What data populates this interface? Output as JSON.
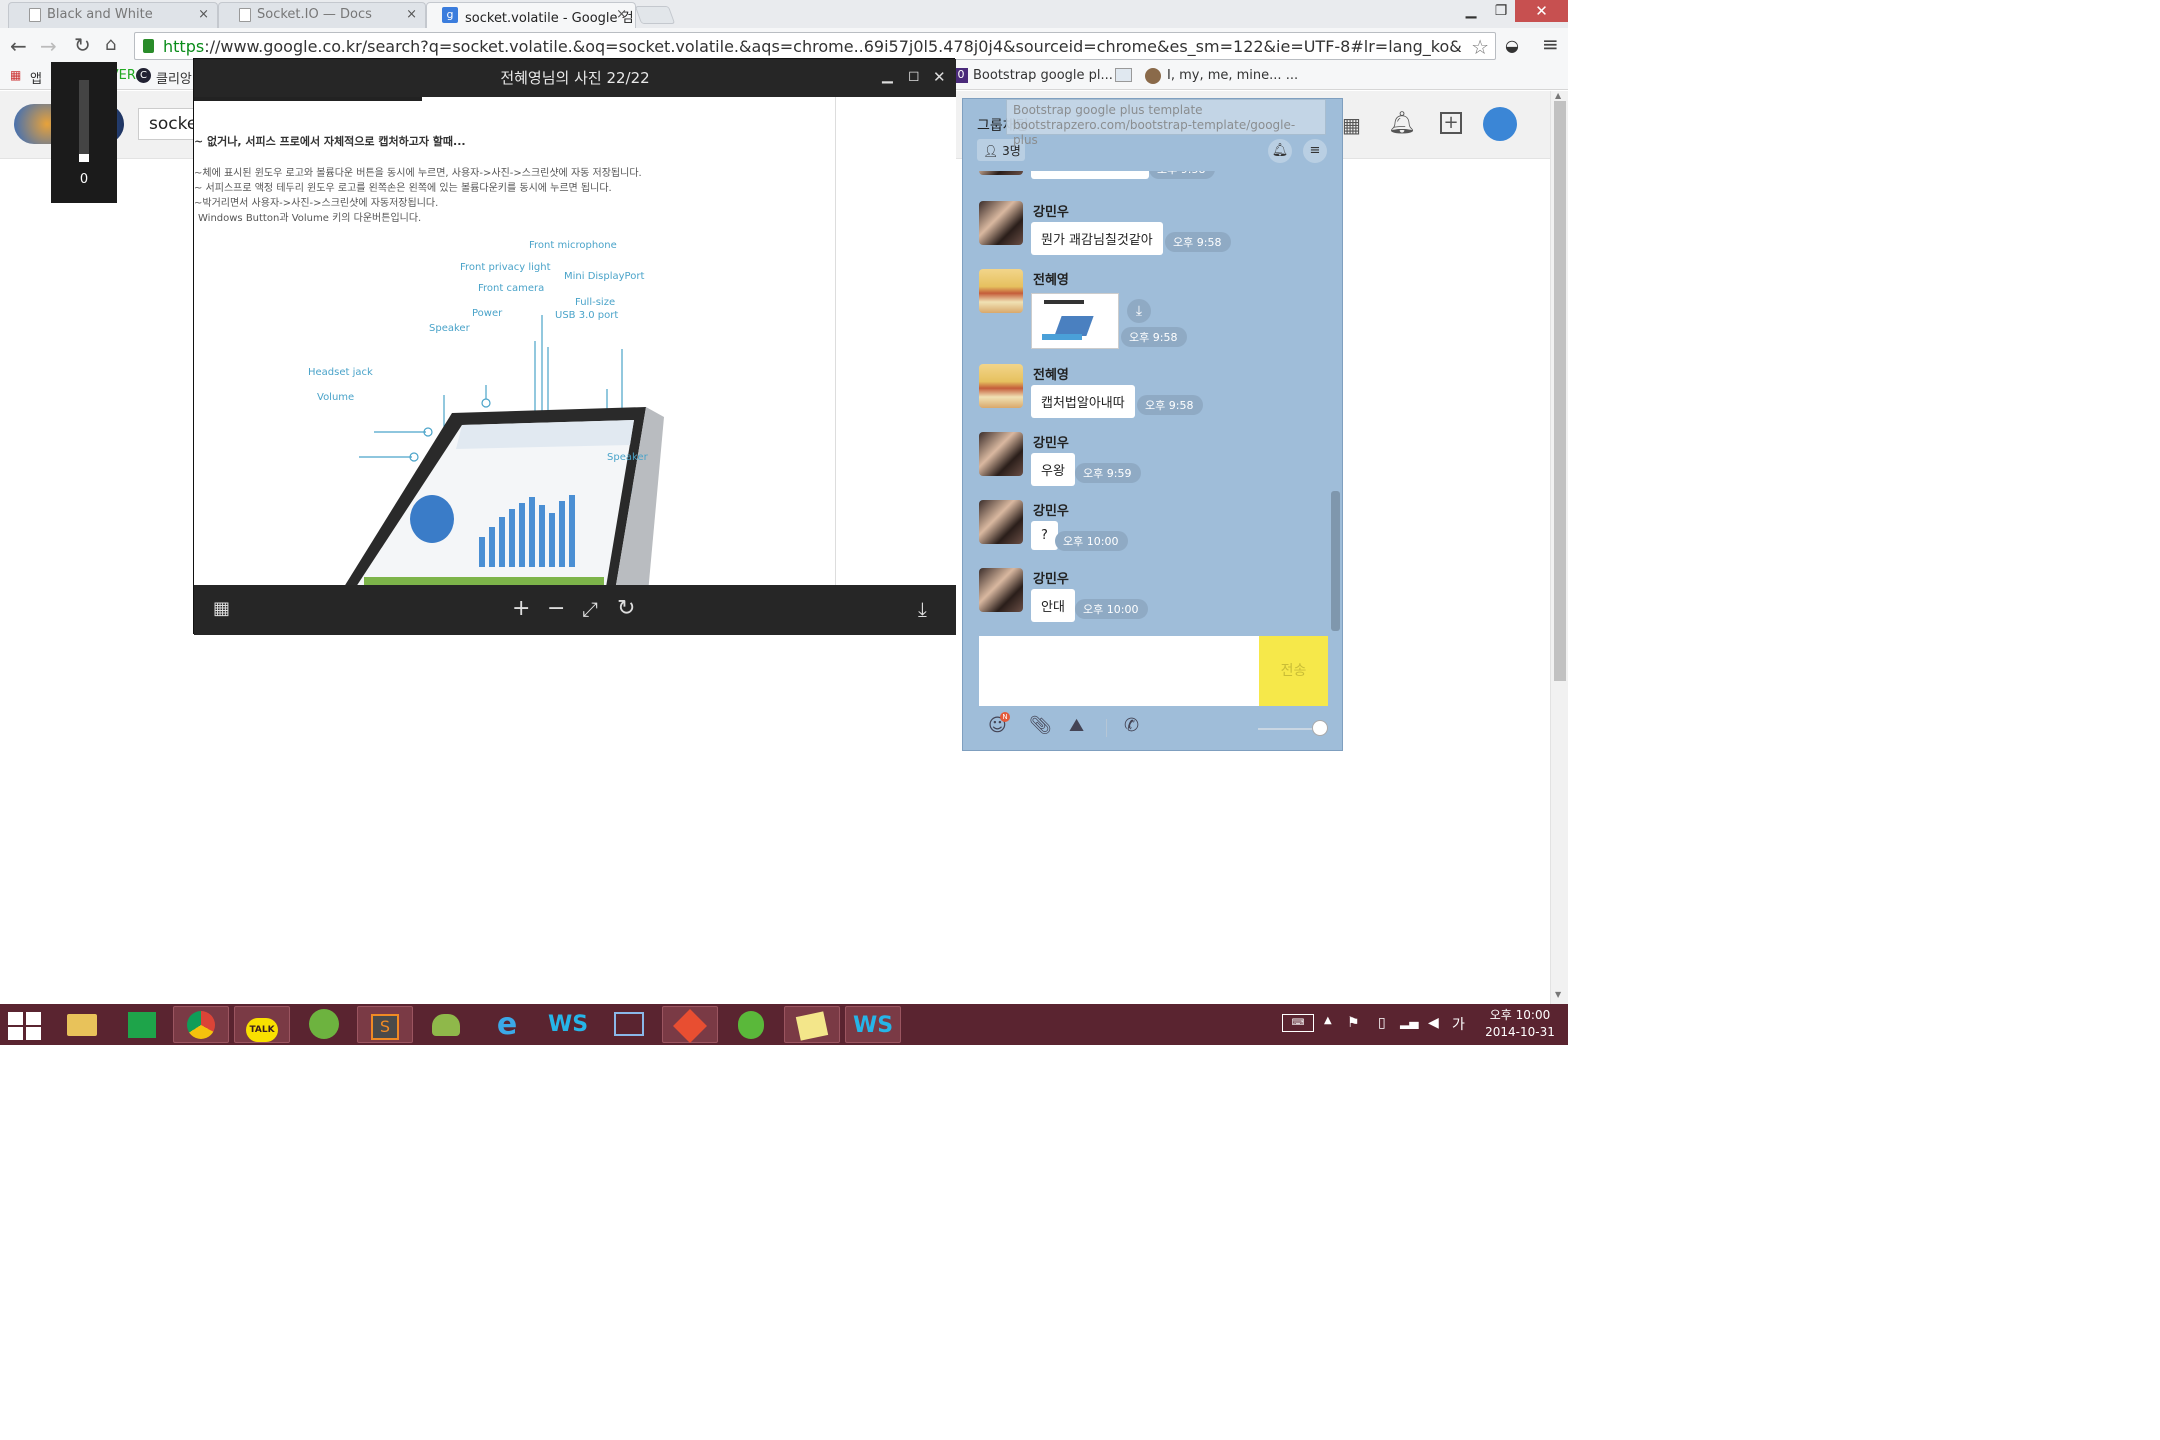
{
  "browser": {
    "tabs": [
      {
        "title": "Black and White"
      },
      {
        "title": "Socket.IO — Docs"
      },
      {
        "title": "socket.volatile - Google 검"
      }
    ],
    "close_glyph": "×",
    "url_scheme": "https",
    "url_rest": "://www.google.co.kr/search?q=socket.volatile.&oq=socket.volatile.&aqs=chrome..69i57j0l5.478j0j4&sourceid=chrome&es_sm=122&ie=UTF-8#lr=lang_ko&ne",
    "bookmarks": {
      "apps": "앱",
      "naver": "NAVER",
      "clien": "클리앙",
      "bootstrap": "Bootstrap google pl...",
      "imine": "I, my, me, mine... ..."
    }
  },
  "google": {
    "search_value": "socke"
  },
  "volume_osd": {
    "value": "0"
  },
  "viewer": {
    "title": "전혜영님의 사진 22/22",
    "doc_heading": "~ 없거나, 서피스 프로에서 자체적으로 캡처하고자 할때...",
    "doc_lines": [
      "~체에 표시된 윈도우 로고와 볼륨다운 버튼을 동시에 누르면, 사용자->사진->스크린샷에 자동 저장됩니다.",
      "~ 서피스프로 액정 테두리 윈도우 로고를 왼쪽손은 왼쪽에 있는 볼륨다운키를 동시에 누르면 됩니다.",
      "~박거리면서 사용자->사진->스크린샷에 자동저장됩니다.",
      "Windows Button과 Volume 키의 다운버튼입니다."
    ],
    "device_labels": {
      "front_microphone": "Front microphone",
      "front_privacy_light": "Front privacy light",
      "mini_displayport": "Mini DisplayPort",
      "front_camera": "Front camera",
      "full_size": "Full-size",
      "usb": "USB 3.0 port",
      "power": "Power",
      "speaker_left": "Speaker",
      "headset_jack": "Headset jack",
      "volume": "Volume",
      "speaker_right": "Speaker"
    }
  },
  "chat": {
    "title": "그룹채팅",
    "members": "3명",
    "tooltip_title": "Bootstrap google plus template",
    "tooltip_url": "bootstrapzero.com/bootstrap-template/google-plus",
    "top_partial_time": "오후 9:58",
    "messages": [
      {
        "sender": "강민우",
        "text": "뭔가 괘감님칠것같아",
        "time": "오후 9:58",
        "avatar": "m"
      },
      {
        "sender": "전혜영",
        "text": "",
        "time": "오후 9:58",
        "avatar": "f",
        "image": true
      },
      {
        "sender": "전혜영",
        "text": "캡처법알아내따",
        "time": "오후 9:58",
        "avatar": "f"
      },
      {
        "sender": "강민우",
        "text": "우왕",
        "time": "오후 9:59",
        "avatar": "m"
      },
      {
        "sender": "강민우",
        "text": "?",
        "time": "오후 10:00",
        "avatar": "m"
      },
      {
        "sender": "강민우",
        "text": "안대",
        "time": "오후 10:00",
        "avatar": "m"
      }
    ],
    "send_label": "전송",
    "emoji_badge": "N"
  },
  "taskbar": {
    "apps": [
      "file-explorer",
      "store",
      "chrome",
      "kakaotalk",
      "spring-tool-suite",
      "sublime-text",
      "android-tool",
      "internet-explorer",
      "webstorm",
      "network-tool",
      "git",
      "frog-app",
      "sticky-notes",
      "webstorm-2"
    ],
    "kakaotalk_label": "TALK",
    "ime": "가",
    "time": "오후 10:00",
    "date": "2014-10-31"
  }
}
